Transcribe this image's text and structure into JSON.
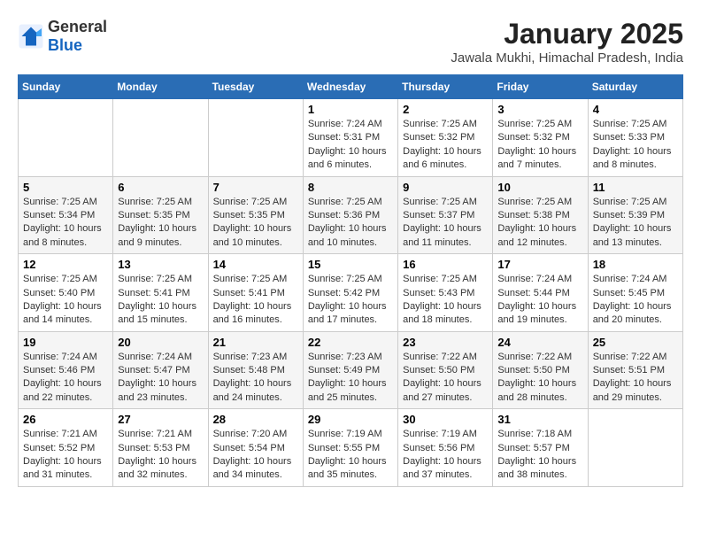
{
  "header": {
    "logo_general": "General",
    "logo_blue": "Blue",
    "month_title": "January 2025",
    "location": "Jawala Mukhi, Himachal Pradesh, India"
  },
  "days_of_week": [
    "Sunday",
    "Monday",
    "Tuesday",
    "Wednesday",
    "Thursday",
    "Friday",
    "Saturday"
  ],
  "weeks": [
    [
      {
        "day": "",
        "info": ""
      },
      {
        "day": "",
        "info": ""
      },
      {
        "day": "",
        "info": ""
      },
      {
        "day": "1",
        "info": "Sunrise: 7:24 AM\nSunset: 5:31 PM\nDaylight: 10 hours\nand 6 minutes."
      },
      {
        "day": "2",
        "info": "Sunrise: 7:25 AM\nSunset: 5:32 PM\nDaylight: 10 hours\nand 6 minutes."
      },
      {
        "day": "3",
        "info": "Sunrise: 7:25 AM\nSunset: 5:32 PM\nDaylight: 10 hours\nand 7 minutes."
      },
      {
        "day": "4",
        "info": "Sunrise: 7:25 AM\nSunset: 5:33 PM\nDaylight: 10 hours\nand 8 minutes."
      }
    ],
    [
      {
        "day": "5",
        "info": "Sunrise: 7:25 AM\nSunset: 5:34 PM\nDaylight: 10 hours\nand 8 minutes."
      },
      {
        "day": "6",
        "info": "Sunrise: 7:25 AM\nSunset: 5:35 PM\nDaylight: 10 hours\nand 9 minutes."
      },
      {
        "day": "7",
        "info": "Sunrise: 7:25 AM\nSunset: 5:35 PM\nDaylight: 10 hours\nand 10 minutes."
      },
      {
        "day": "8",
        "info": "Sunrise: 7:25 AM\nSunset: 5:36 PM\nDaylight: 10 hours\nand 10 minutes."
      },
      {
        "day": "9",
        "info": "Sunrise: 7:25 AM\nSunset: 5:37 PM\nDaylight: 10 hours\nand 11 minutes."
      },
      {
        "day": "10",
        "info": "Sunrise: 7:25 AM\nSunset: 5:38 PM\nDaylight: 10 hours\nand 12 minutes."
      },
      {
        "day": "11",
        "info": "Sunrise: 7:25 AM\nSunset: 5:39 PM\nDaylight: 10 hours\nand 13 minutes."
      }
    ],
    [
      {
        "day": "12",
        "info": "Sunrise: 7:25 AM\nSunset: 5:40 PM\nDaylight: 10 hours\nand 14 minutes."
      },
      {
        "day": "13",
        "info": "Sunrise: 7:25 AM\nSunset: 5:41 PM\nDaylight: 10 hours\nand 15 minutes."
      },
      {
        "day": "14",
        "info": "Sunrise: 7:25 AM\nSunset: 5:41 PM\nDaylight: 10 hours\nand 16 minutes."
      },
      {
        "day": "15",
        "info": "Sunrise: 7:25 AM\nSunset: 5:42 PM\nDaylight: 10 hours\nand 17 minutes."
      },
      {
        "day": "16",
        "info": "Sunrise: 7:25 AM\nSunset: 5:43 PM\nDaylight: 10 hours\nand 18 minutes."
      },
      {
        "day": "17",
        "info": "Sunrise: 7:24 AM\nSunset: 5:44 PM\nDaylight: 10 hours\nand 19 minutes."
      },
      {
        "day": "18",
        "info": "Sunrise: 7:24 AM\nSunset: 5:45 PM\nDaylight: 10 hours\nand 20 minutes."
      }
    ],
    [
      {
        "day": "19",
        "info": "Sunrise: 7:24 AM\nSunset: 5:46 PM\nDaylight: 10 hours\nand 22 minutes."
      },
      {
        "day": "20",
        "info": "Sunrise: 7:24 AM\nSunset: 5:47 PM\nDaylight: 10 hours\nand 23 minutes."
      },
      {
        "day": "21",
        "info": "Sunrise: 7:23 AM\nSunset: 5:48 PM\nDaylight: 10 hours\nand 24 minutes."
      },
      {
        "day": "22",
        "info": "Sunrise: 7:23 AM\nSunset: 5:49 PM\nDaylight: 10 hours\nand 25 minutes."
      },
      {
        "day": "23",
        "info": "Sunrise: 7:22 AM\nSunset: 5:50 PM\nDaylight: 10 hours\nand 27 minutes."
      },
      {
        "day": "24",
        "info": "Sunrise: 7:22 AM\nSunset: 5:50 PM\nDaylight: 10 hours\nand 28 minutes."
      },
      {
        "day": "25",
        "info": "Sunrise: 7:22 AM\nSunset: 5:51 PM\nDaylight: 10 hours\nand 29 minutes."
      }
    ],
    [
      {
        "day": "26",
        "info": "Sunrise: 7:21 AM\nSunset: 5:52 PM\nDaylight: 10 hours\nand 31 minutes."
      },
      {
        "day": "27",
        "info": "Sunrise: 7:21 AM\nSunset: 5:53 PM\nDaylight: 10 hours\nand 32 minutes."
      },
      {
        "day": "28",
        "info": "Sunrise: 7:20 AM\nSunset: 5:54 PM\nDaylight: 10 hours\nand 34 minutes."
      },
      {
        "day": "29",
        "info": "Sunrise: 7:19 AM\nSunset: 5:55 PM\nDaylight: 10 hours\nand 35 minutes."
      },
      {
        "day": "30",
        "info": "Sunrise: 7:19 AM\nSunset: 5:56 PM\nDaylight: 10 hours\nand 37 minutes."
      },
      {
        "day": "31",
        "info": "Sunrise: 7:18 AM\nSunset: 5:57 PM\nDaylight: 10 hours\nand 38 minutes."
      },
      {
        "day": "",
        "info": ""
      }
    ]
  ]
}
